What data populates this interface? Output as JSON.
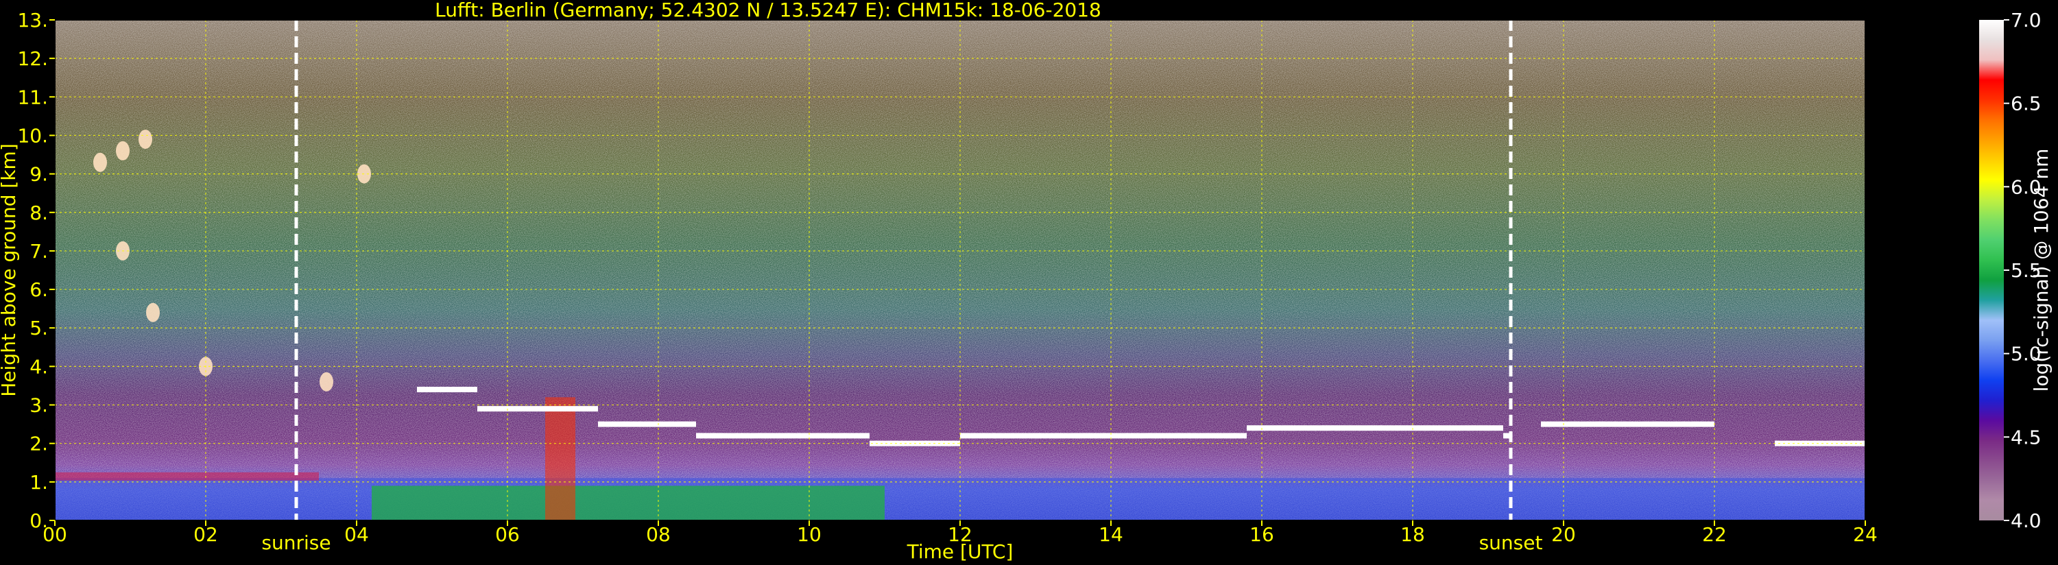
{
  "chart_data": {
    "type": "heatmap",
    "title": "Lufft: Berlin (Germany; 52.4302 N / 13.5247 E):    CHM15k: 18-06-2018",
    "xlabel": "Time [UTC]",
    "ylabel": "Height above ground [km]",
    "x_ticks": [
      "00",
      "02",
      "04",
      "06",
      "08",
      "10",
      "12",
      "14",
      "16",
      "18",
      "20",
      "22",
      "24"
    ],
    "y_ticks": [
      "0.",
      "1.",
      "2.",
      "3.",
      "4.",
      "5.",
      "6.",
      "7.",
      "8.",
      "9.",
      "10.",
      "11.",
      "12.",
      "13."
    ],
    "xlim": [
      0,
      24
    ],
    "ylim": [
      0,
      13
    ],
    "grid": true,
    "annotations": [
      {
        "label": "sunrise",
        "x": 3.2
      },
      {
        "label": "sunset",
        "x": 19.3
      }
    ],
    "colorbar": {
      "label": "log(rc-signal) @ 1064 nm",
      "ticks": [
        "4.0",
        "4.5",
        "5.0",
        "5.5",
        "6.0",
        "6.5",
        "7.0"
      ],
      "range": [
        4.0,
        7.0
      ],
      "colors": [
        "#a88ba0",
        "#b08aa8",
        "#9a6a9a",
        "#8a4a8e",
        "#7a2a86",
        "#5a0aa0",
        "#2020d0",
        "#1040f0",
        "#4a70f0",
        "#7aa0f0",
        "#a0c0f8",
        "#20a0a0",
        "#10a040",
        "#30c050",
        "#50d070",
        "#80e060",
        "#c0f040",
        "#ffff00",
        "#ffd000",
        "#ffa000",
        "#ff7000",
        "#ff3000",
        "#ff0000",
        "#f0c0c0",
        "#e8e0e0",
        "#ffffff"
      ]
    },
    "features": {
      "cloud_layer_km": [
        {
          "t0": 4.8,
          "t1": 5.6,
          "h": 3.4
        },
        {
          "t0": 5.6,
          "t1": 7.2,
          "h": 2.9
        },
        {
          "t0": 7.2,
          "t1": 8.5,
          "h": 2.5
        },
        {
          "t0": 8.5,
          "t1": 10.8,
          "h": 2.2
        },
        {
          "t0": 10.8,
          "t1": 12.0,
          "h": 2.0
        },
        {
          "t0": 12.0,
          "t1": 13.0,
          "h": 2.2
        },
        {
          "t0": 13.0,
          "t1": 15.8,
          "h": 2.2
        },
        {
          "t0": 15.8,
          "t1": 19.2,
          "h": 2.4
        },
        {
          "t0": 19.2,
          "t1": 19.3,
          "h": 2.2
        },
        {
          "t0": 19.7,
          "t1": 22.0,
          "h": 2.5
        },
        {
          "t0": 22.8,
          "t1": 24.0,
          "h": 2.0
        }
      ],
      "cirrus_km": [
        {
          "t": 0.6,
          "h": 9.3
        },
        {
          "t": 0.9,
          "h": 9.6
        },
        {
          "t": 1.2,
          "h": 9.9
        },
        {
          "t": 0.9,
          "h": 7.0
        },
        {
          "t": 1.3,
          "h": 5.4
        },
        {
          "t": 2.0,
          "h": 4.0
        },
        {
          "t": 3.6,
          "h": 3.6
        },
        {
          "t": 4.1,
          "h": 9.0
        }
      ]
    }
  }
}
